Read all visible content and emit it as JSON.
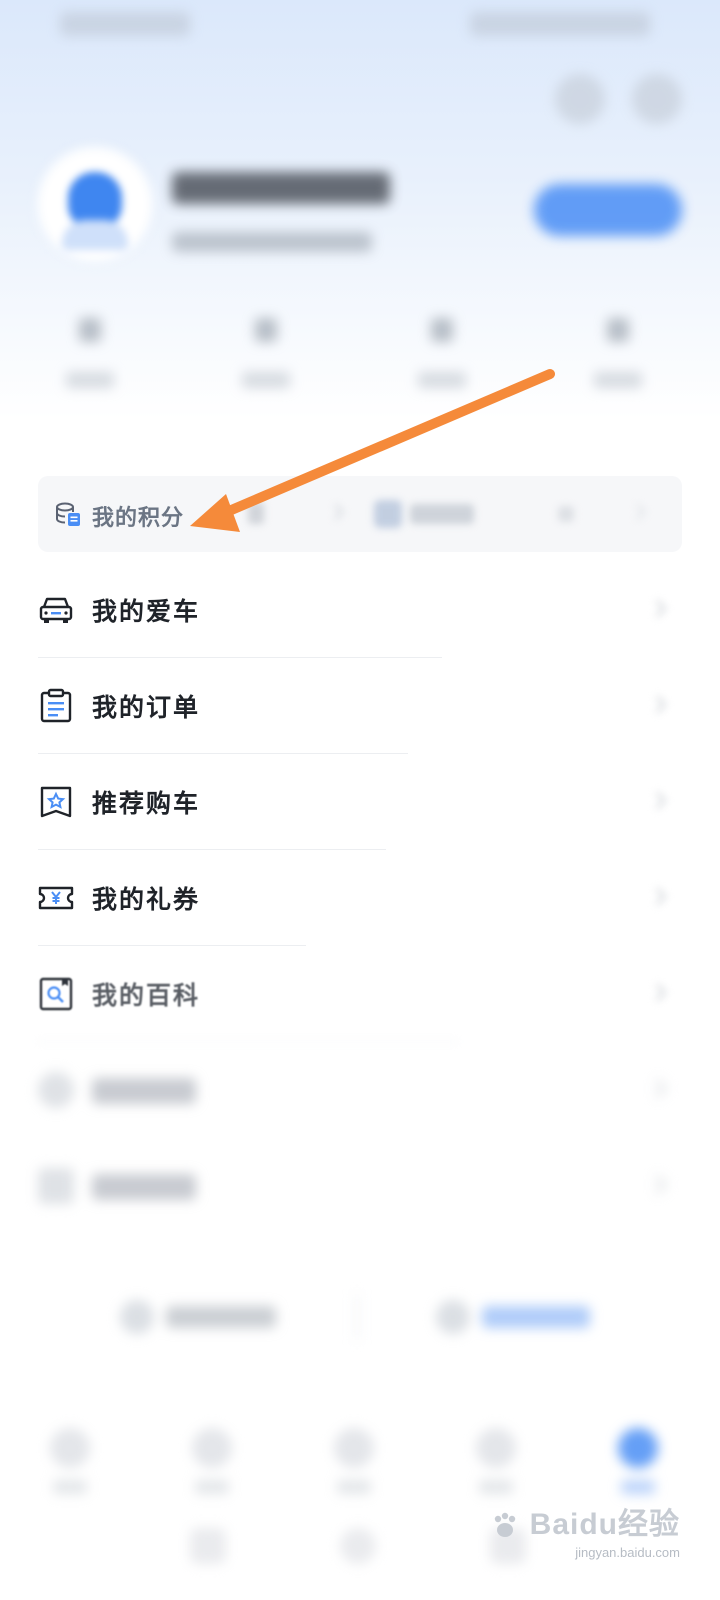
{
  "points": {
    "label": "我的积分",
    "icon": "database-icon"
  },
  "menu": [
    {
      "label": "我的爱车",
      "icon": "car-icon"
    },
    {
      "label": "我的订单",
      "icon": "clipboard-icon"
    },
    {
      "label": "推荐购车",
      "icon": "star-bookmark-icon"
    },
    {
      "label": "我的礼券",
      "icon": "yen-ticket-icon"
    },
    {
      "label": "我的百科",
      "icon": "search-book-icon"
    }
  ],
  "tabs_active_index": 4,
  "annotation": {
    "color": "#f58a3a"
  },
  "watermark": {
    "logo": "Baidu经验",
    "url": "jingyan.baidu.com"
  },
  "colors": {
    "accent": "#4a8ef5",
    "annotation_arrow": "#f58a3a",
    "text_primary": "#1f2329"
  }
}
